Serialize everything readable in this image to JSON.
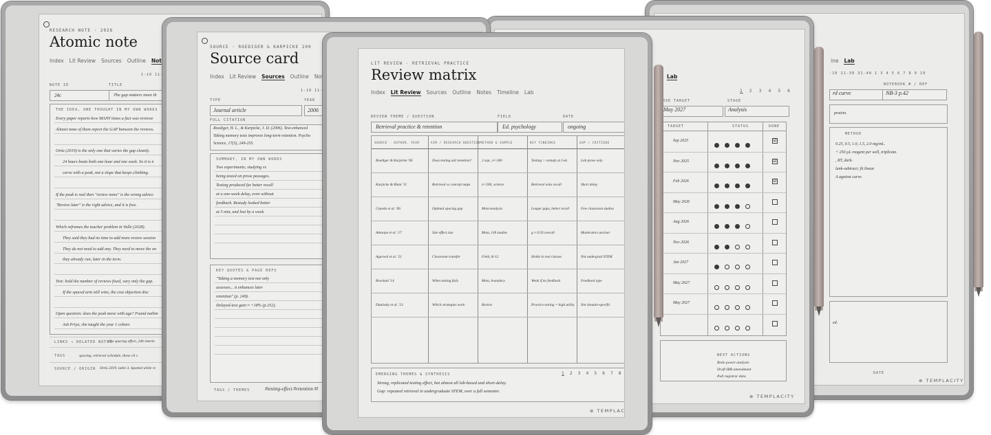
{
  "atomic": {
    "header": "RESEARCH NOTE · 2026",
    "title": "Atomic note",
    "tabs": [
      "Index",
      "Lit Review",
      "Sources",
      "Outline",
      "Note"
    ],
    "note_id_label": "NOTE ID",
    "note_id": "24c",
    "title_label": "TITLE",
    "title_value": "The gap matters more th",
    "pager": "1-10  11-2",
    "idea_label": "THE IDEA, ONE THOUGHT IN MY OWN WORDS",
    "lines": [
      "Every paper reports how MANY times a fact was reviewe",
      "Almost none of them report the GAP between the reviews.",
      "",
      "Ortiz (2019) is the only one that varies the gap cleanly.",
      "24 hours beats both one hour and one week. So it is n",
      "curve with a peak, not a slope that keeps climbing.",
      "",
      "If the peak is real then \"review more\" is the wrong advice",
      "\"Review later\" is the right advice, and it is free.",
      "",
      "Which reframes the teacher problem in Valle (2028).",
      "They said they had no time to add more review session",
      "They do not need to add any. They need to move the on",
      "they already run, later in the term.",
      "",
      "Test: hold the number of reviews fixed, vary only the gap.",
      "If the spaced arm still wins, the cost objection disc",
      "",
      "Open question: does the peak move with age? Found nothin",
      "Ask Priya, she taught the year 1 cohort."
    ],
    "links_label": "LINKS → RELATED NOTES",
    "links_value": "24a spacing effect, 24b interle",
    "tags_label": "TAGS",
    "tags_value": "spacing, retrieval schedule, these ch s",
    "source_label": "SOURCE / ORIGIN",
    "source_value": "Ortiz 2019, table 3. Spotted while re"
  },
  "source": {
    "header": "SOURCE · ROEDIGER & KARPICKE 200",
    "title": "Source card",
    "tabs": [
      "Index",
      "Lit Review",
      "Sources",
      "Outline",
      "Note"
    ],
    "pager": "1-10  11-2",
    "type_label": "TYPE",
    "type_value": "Journal article",
    "year_label": "YEAR",
    "year_value": "2006",
    "citation_label": "FULL CITATION",
    "citation_lines": [
      "Roediger, H. L., & Karpicke, J. D. (2006). Test-enhanced",
      "Taking memory tests improves long-term retention. Psycho",
      "Science, 17(3), 249-255."
    ],
    "summary_label": "SUMMARY, IN MY OWN WORDS",
    "summary_lines": [
      "Two experiments; studying vs",
      "being tested on prose passages.",
      "Testing produced far better recall",
      "at a one-week delay, even without",
      "feedback. Restudy looked better",
      "at 5 min, and lost by a week."
    ],
    "quotes_label": "KEY QUOTES & PAGE REFS",
    "quotes_lines": [
      "\"Taking a memory test not only",
      "assesses... it enhances later",
      "retention\" (p. 249).",
      "Delayed-test gain ≈ +18% (p.252)."
    ],
    "tags_label": "TAGS / THEMES",
    "tags_value": "#testing-effect  #retention  #l"
  },
  "matrix": {
    "header": "LIT REVIEW · RETRIEVAL PRACTICE",
    "title": "Review matrix",
    "tabs": [
      "Index",
      "Lit Review",
      "Sources",
      "Outline",
      "Notes",
      "Timeline",
      "Lab"
    ],
    "active_tab": "Lit Review",
    "theme_label": "REVIEW THEME / QUESTION",
    "theme_value": "Retrieval practice & retention",
    "field_label": "FIELD",
    "field_value": "Ed. psychology",
    "date_label": "DATE",
    "date_value": "ongoing",
    "columns": [
      "SOURCE · AUTHOR, YEAR",
      "AIM / RESEARCH QUESTION",
      "METHOD & SAMPLE",
      "KEY FINDINGS",
      "GAP / CRITIQUE"
    ],
    "rows": [
      [
        "Roediger & Karpicke '06",
        "Does testing aid retention?",
        "2 exp., n=180",
        "Testing > restudy at 1wk",
        "Lab prose only"
      ],
      [
        "Karpicke & Blunt '11",
        "Retrieval vs concept maps",
        "n=200, science",
        "Retrieval wins recall",
        "Short delay"
      ],
      [
        "Cepeda et al. '06",
        "Optimal spacing gap",
        "Meta-analysis",
        "Longer gaps, better recall",
        "Few classroom studies"
      ],
      [
        "Adesope et al. '17",
        "Size effect size",
        "Meta, 118 studies",
        "g ≈ 0.50 overall",
        "Moderators unclear"
      ],
      [
        "Agarwal et al. '21",
        "Classroom transfer",
        "Field, K-12",
        "Holds in real classes",
        "Not undergrad STEM"
      ],
      [
        "Rowland '14",
        "When testing fails",
        "Meta, boundary",
        "Weak if no feedback",
        "Feedback type"
      ],
      [
        "Dunlosky et al. '13",
        "Which strategies work",
        "Review",
        "Practice testing = high utility",
        "Not domain-specific"
      ],
      [
        "",
        "",
        "",
        "",
        ""
      ]
    ],
    "themes_label": "EMERGING THEMES & SYNTHESIS",
    "themes_lines": [
      "Strong, replicated testing effect, but almost all lab-based and short-delay.",
      "Gap: repeated retrieval in undergraduate STEM, over a full semester."
    ],
    "pager": [
      "1",
      "2",
      "3",
      "4",
      "5",
      "6",
      "7",
      "8"
    ],
    "logo": "TEMPLACITY"
  },
  "progress": {
    "tab_fragment": "Lab",
    "page_nums": [
      "1",
      "2",
      "3",
      "4",
      "5",
      "6"
    ],
    "target_label": "ERSE TARGET",
    "target_value": "May 2027",
    "stage_label": "STAGE",
    "stage_value": "Analysis",
    "col_target": "TARGET",
    "col_status": "STATUS",
    "col_done": "DONE",
    "rows": [
      {
        "date": "Sep 2025",
        "filled": 4,
        "done": "☑"
      },
      {
        "date": "Nov 2025",
        "filled": 4,
        "done": "☑"
      },
      {
        "date": "Feb 2026",
        "filled": 4,
        "done": "☑"
      },
      {
        "date": "May 2026",
        "filled": 3,
        "done": ""
      },
      {
        "date": "Aug 2026",
        "filled": 3,
        "done": ""
      },
      {
        "date": "Nov 2026",
        "filled": 2,
        "done": ""
      },
      {
        "date": "Jan 2027",
        "filled": 1,
        "done": ""
      },
      {
        "date": "May 2027",
        "filled": 0,
        "done": ""
      },
      {
        "date": "May 2027",
        "filled": 0,
        "done": ""
      },
      {
        "date": "",
        "filled": 0,
        "done": ""
      }
    ],
    "next_label": "NEXT ACTIONS",
    "next_lines": [
      "Redo power analysis",
      "Draft IRB amendment",
      "Pull registrar data"
    ]
  },
  "lab": {
    "tabs": [
      "ine",
      "Lab"
    ],
    "pager": "-10  21-30  31-40  1  3  4  5  6  7  8  9  10",
    "notebook_label": "NOTEBOOK # / REF",
    "left_value": "rd curve",
    "notebook_value": "NB-3 p.42",
    "note": "protein.",
    "method_label": "METHOD",
    "method_lines": [
      "0.25, 0.5, 1.0, 1.5, 2.0 mg/mL.",
      "+ 250 µL reagent per well, triplicate.",
      ", RT, dark.",
      "lank-subtract; fit linear.",
      "A against curve."
    ],
    "bottom_frag": "ed.",
    "date_label": "DATE",
    "logo": "TEMPLACITY"
  }
}
